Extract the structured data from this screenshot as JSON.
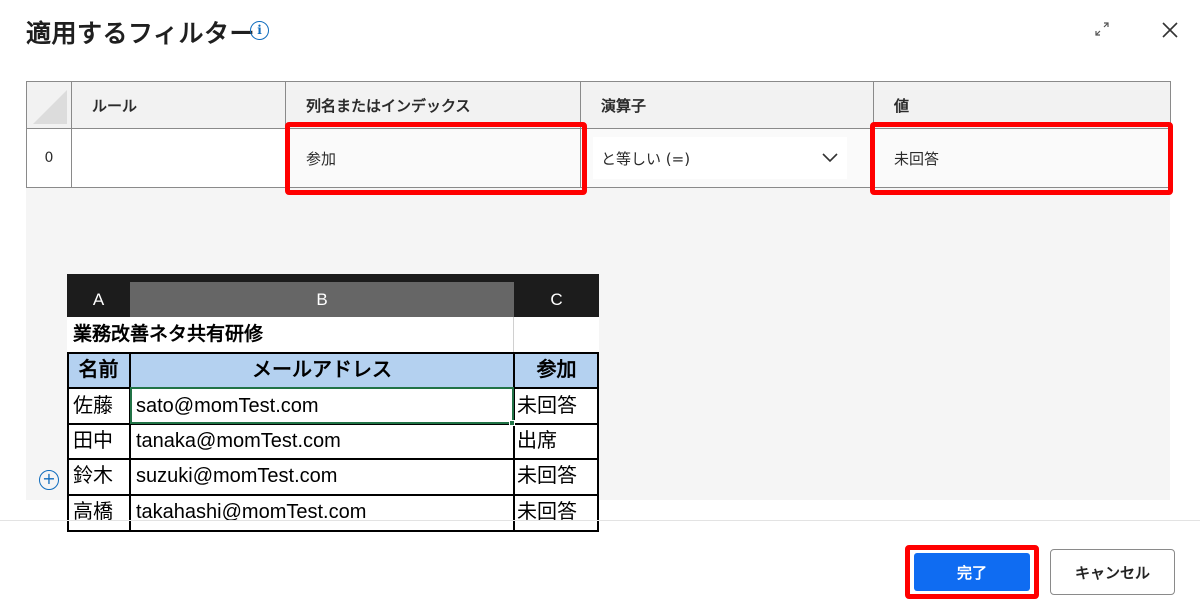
{
  "dialog": {
    "title": "適用するフィルター",
    "info_icon": "i"
  },
  "rules_table": {
    "headers": [
      "ルール",
      "列名またはインデックス",
      "演算子",
      "値"
    ],
    "rows": [
      {
        "index": "0",
        "rule": "",
        "column": "参加",
        "operator": "と等しい (=)",
        "value": "未回答"
      }
    ]
  },
  "spreadsheet": {
    "col_headers": [
      "A",
      "B",
      "C"
    ],
    "title": "業務改善ネタ共有研修",
    "header_row": [
      "名前",
      "メールアドレス",
      "参加"
    ],
    "rows": [
      [
        "佐藤",
        "sato@momTest.com",
        "未回答"
      ],
      [
        "田中",
        "tanaka@momTest.com",
        "出席"
      ],
      [
        "鈴木",
        "suzuki@momTest.com",
        "未回答"
      ],
      [
        "高橋",
        "takahashi@momTest.com",
        "未回答"
      ]
    ]
  },
  "footer": {
    "done_label": "完了",
    "cancel_label": "キャンセル"
  },
  "colors": {
    "accent": "#0f6cf2",
    "highlight": "#ff0000",
    "excel_header_fill": "#b4d1f0",
    "excel_selected_border": "#217346"
  },
  "icons": [
    "info-icon",
    "expand-icon",
    "close-icon",
    "chevron-down-icon",
    "add-circle-icon"
  ]
}
